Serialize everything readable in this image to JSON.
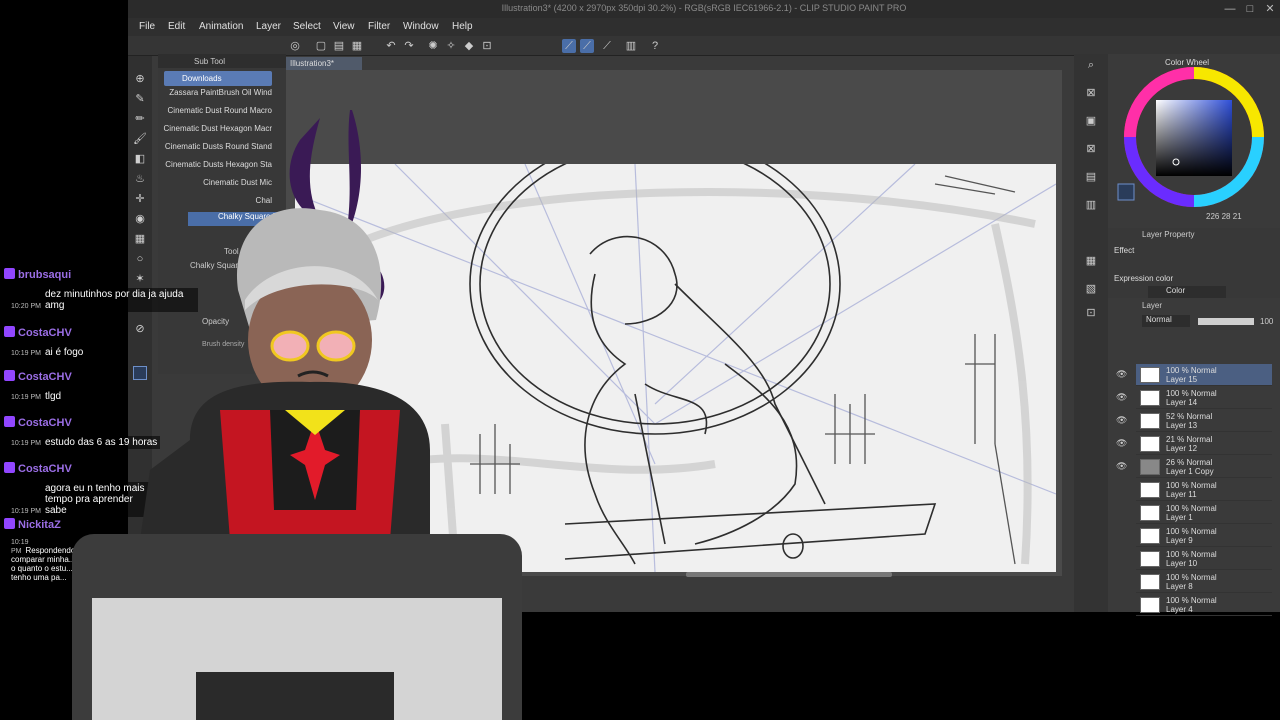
{
  "window": {
    "title": "Illustration3* (4200 x 2970px 350dpi 30.2%) - RGB(sRGB IEC61966-2.1) - CLIP STUDIO PAINT PRO",
    "controls": [
      "—",
      "□",
      "✕"
    ]
  },
  "menu": [
    "File",
    "Edit",
    "Animation",
    "Layer",
    "Select",
    "View",
    "Filter",
    "Window",
    "Help"
  ],
  "subtool": {
    "title": "Sub Tool",
    "tab": "Downloads",
    "brushes": [
      "Zassara PaintBrush Oil Wind",
      "Cinematic Dust Round Macro",
      "Cinematic Dust Hexagon Macr",
      "Cinematic Dusts Round Stand",
      "Cinematic Dusts Hexagon Sta",
      "Cinematic Dust Mic",
      "Chal",
      "Chalky Square Painting"
    ]
  },
  "toolprop": {
    "title": "Tool Property",
    "name": "Chalky Square Pa",
    "opacity": "Opacity",
    "density": "Brush density"
  },
  "canvas": {
    "tab": "Illustration3*"
  },
  "colorwheel": {
    "title": "Color Wheel",
    "values": "226 28 21"
  },
  "layerprop": {
    "title": "Layer Property",
    "effect": "Effect",
    "expression": "Expression color",
    "color": "Color"
  },
  "layers": {
    "title": "Layer",
    "blend": "Normal",
    "opacity": "100",
    "items": [
      {
        "mode": "100 % Normal",
        "name": "Layer 15"
      },
      {
        "mode": "100 % Normal",
        "name": "Layer 14"
      },
      {
        "mode": "52 % Normal",
        "name": "Layer 13"
      },
      {
        "mode": "21 % Normal",
        "name": "Layer 12"
      },
      {
        "mode": "26 % Normal",
        "name": "Layer 1 Copy"
      },
      {
        "mode": "100 % Normal",
        "name": "Layer 11"
      },
      {
        "mode": "100 % Normal",
        "name": "Layer 1"
      },
      {
        "mode": "100 % Normal",
        "name": "Layer 9"
      },
      {
        "mode": "100 % Normal",
        "name": "Layer 10"
      },
      {
        "mode": "100 % Normal",
        "name": "Layer 8"
      },
      {
        "mode": "100 % Normal",
        "name": "Layer 4"
      }
    ]
  },
  "chat": [
    {
      "user": "brubsaqui",
      "time": "10:20 PM",
      "msg": "dez minutinhos por dia ja ajuda amg"
    },
    {
      "user": "CostaCHV",
      "time": "10:19 PM",
      "msg": "ai é fogo"
    },
    {
      "user": "CostaCHV",
      "time": "10:19 PM",
      "msg": "tlgd"
    },
    {
      "user": "CostaCHV",
      "time": "10:19 PM",
      "msg": "estudo das 6 as 19 horas"
    },
    {
      "user": "CostaCHV",
      "time": "10:19 PM",
      "msg": "agora eu n tenho mais tempo pra aprender sabe"
    },
    {
      "user": "NickitaZ",
      "time": "10:19 PM",
      "msg": "Respondendo... comparar minha... o quanto o estu... tenho uma pa..."
    }
  ]
}
